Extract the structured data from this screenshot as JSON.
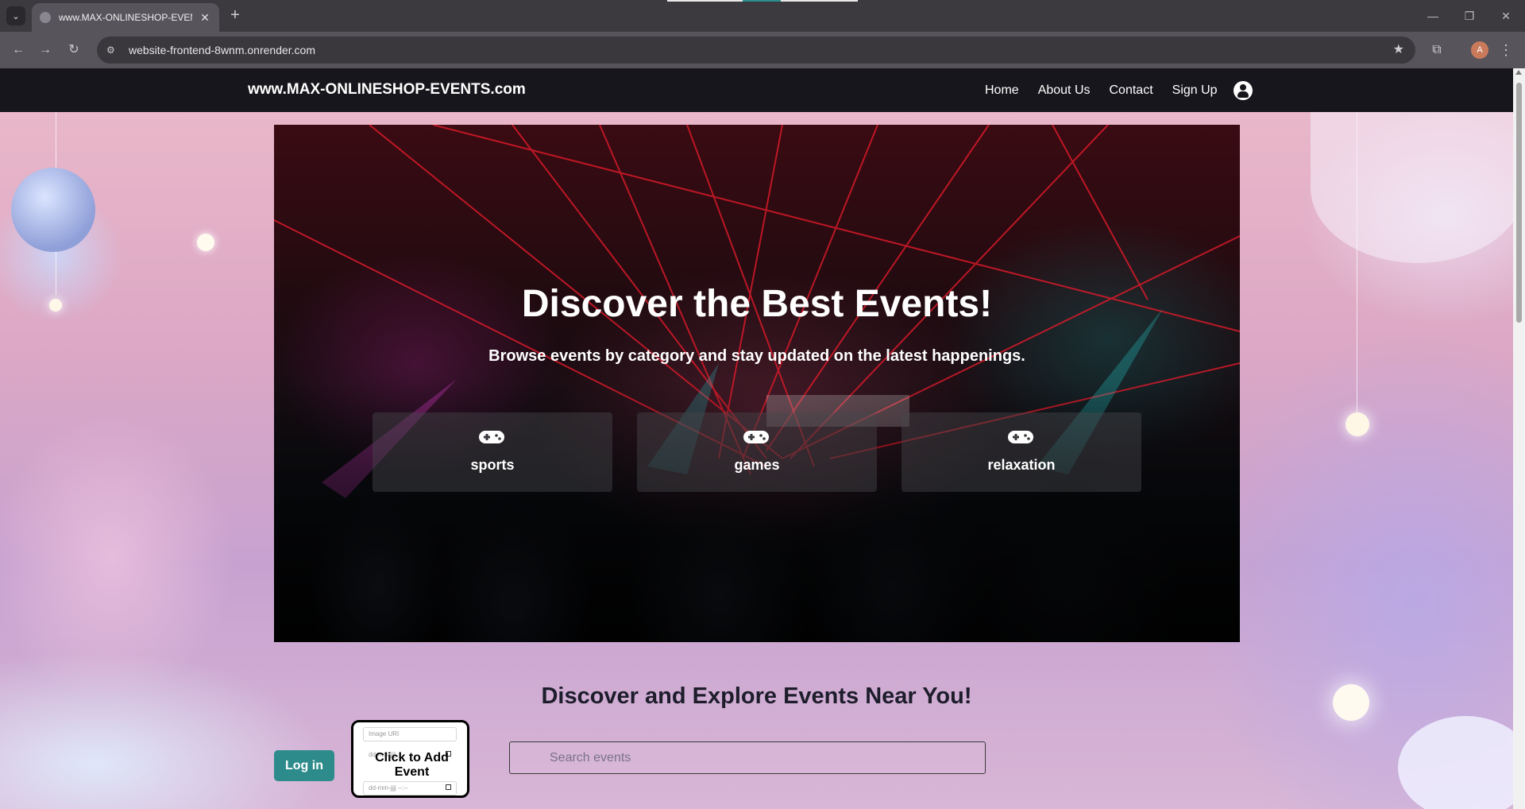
{
  "browser": {
    "tab_title": "www.MAX-ONLINESHOP-EVEN",
    "url": "website-frontend-8wnm.onrender.com",
    "profile_initial": "A"
  },
  "site": {
    "brand": "www.MAX-ONLINESHOP-EVENTS.com",
    "nav": {
      "home": "Home",
      "about": "About Us",
      "contact": "Contact",
      "signup": "Sign Up"
    }
  },
  "hero": {
    "title": "Discover the Best Events!",
    "subtitle": "Browse events by category and stay updated on the latest happenings.",
    "categories": [
      {
        "label": "sports",
        "icon": "gamepad-icon"
      },
      {
        "label": "games",
        "icon": "gamepad-icon"
      },
      {
        "label": "relaxation",
        "icon": "gamepad-icon"
      }
    ]
  },
  "main": {
    "section_title": "Discover and Explore Events Near You!",
    "login_label": "Log in",
    "add_event": {
      "label": "Click to Add Event",
      "image_url_placeholder": "Image URI",
      "date_placeholder": "dd-mm-jjjj",
      "datetime_placeholder": "dd-mm-jjjj --:--"
    },
    "search_placeholder": "Search events"
  },
  "colors": {
    "navbar": "#16161c",
    "accent_teal": "#2e8b8b",
    "heading": "#1d1d2b"
  }
}
